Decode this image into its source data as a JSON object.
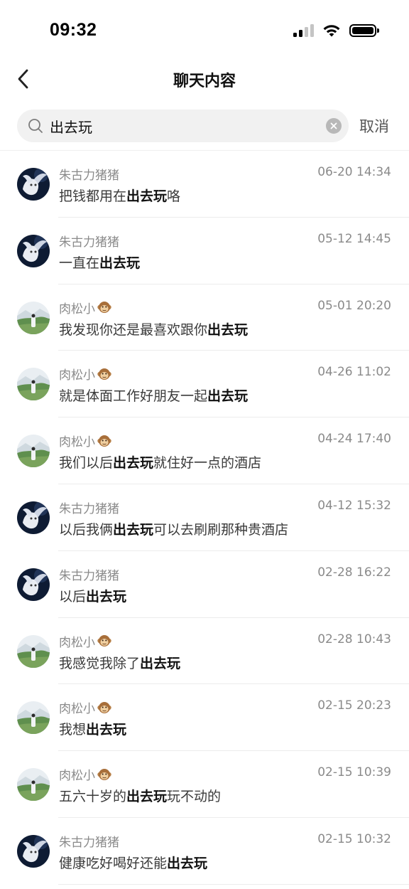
{
  "status_bar": {
    "time": "09:32"
  },
  "nav": {
    "title": "聊天内容"
  },
  "search": {
    "value": "出去玩",
    "cancel_label": "取消"
  },
  "results": [
    {
      "sender": "朱古力猪猪",
      "avatar": "dark-angel",
      "emoji": "",
      "time": "06-20 14:34",
      "before": "把钱都用在",
      "match": "出去玩",
      "after": "咯"
    },
    {
      "sender": "朱古力猪猪",
      "avatar": "dark-angel",
      "emoji": "",
      "time": "05-12 14:45",
      "before": "一直在",
      "match": "出去玩",
      "after": ""
    },
    {
      "sender": "肉松小",
      "avatar": "landscape",
      "emoji": "monkey-icon",
      "time": "05-01 20:20",
      "before": "我发现你还是最喜欢跟你",
      "match": "出去玩",
      "after": ""
    },
    {
      "sender": "肉松小",
      "avatar": "landscape",
      "emoji": "monkey-icon",
      "time": "04-26 11:02",
      "before": "就是体面工作好朋友一起",
      "match": "出去玩",
      "after": ""
    },
    {
      "sender": "肉松小",
      "avatar": "landscape",
      "emoji": "monkey-icon",
      "time": "04-24 17:40",
      "before": "我们以后",
      "match": "出去玩",
      "after": "就住好一点的酒店"
    },
    {
      "sender": "朱古力猪猪",
      "avatar": "dark-angel",
      "emoji": "",
      "time": "04-12 15:32",
      "before": "以后我俩",
      "match": "出去玩",
      "after": "可以去刷刷那种贵酒店"
    },
    {
      "sender": "朱古力猪猪",
      "avatar": "dark-angel",
      "emoji": "",
      "time": "02-28 16:22",
      "before": "以后",
      "match": "出去玩",
      "after": ""
    },
    {
      "sender": "肉松小",
      "avatar": "landscape",
      "emoji": "monkey-icon",
      "time": "02-28 10:43",
      "before": "我感觉我除了",
      "match": "出去玩",
      "after": ""
    },
    {
      "sender": "肉松小",
      "avatar": "landscape",
      "emoji": "monkey-icon",
      "time": "02-15 20:23",
      "before": "我想",
      "match": "出去玩",
      "after": ""
    },
    {
      "sender": "肉松小",
      "avatar": "landscape",
      "emoji": "monkey-icon",
      "time": "02-15 10:39",
      "before": "五六十岁的",
      "match": "出去玩",
      "after": "玩不动的"
    },
    {
      "sender": "朱古力猪猪",
      "avatar": "dark-angel",
      "emoji": "",
      "time": "02-15 10:32",
      "before": "健康吃好喝好还能",
      "match": "出去玩",
      "after": ""
    }
  ]
}
